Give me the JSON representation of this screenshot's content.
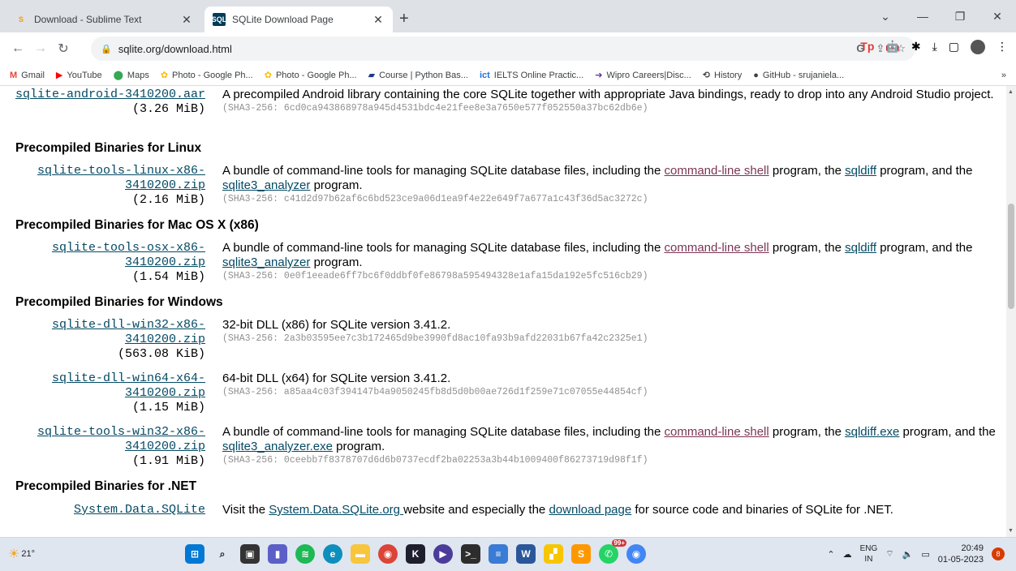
{
  "tabs": [
    {
      "title": "Download - Sublime Text",
      "icon": "sublime-icon",
      "active": false
    },
    {
      "title": "SQLite Download Page",
      "icon": "sqlite-icon",
      "active": true
    }
  ],
  "address_bar": {
    "url": "sqlite.org/download.html"
  },
  "bookmarks": [
    {
      "label": "Gmail",
      "icon": "gmail-icon",
      "color": "#ea4335"
    },
    {
      "label": "YouTube",
      "icon": "youtube-icon",
      "color": "#ff0000"
    },
    {
      "label": "Maps",
      "icon": "maps-icon",
      "color": "#34a853"
    },
    {
      "label": "Photo - Google Ph...",
      "icon": "photos-icon",
      "color": "#fbbc04"
    },
    {
      "label": "Photo - Google Ph...",
      "icon": "photos-icon",
      "color": "#fbbc04"
    },
    {
      "label": "Course | Python Bas...",
      "icon": "course-icon",
      "color": "#1f3c88"
    },
    {
      "label": "IELTS Online Practic...",
      "icon": "ielts-icon",
      "color": "#1a73e8"
    },
    {
      "label": "Wipro Careers|Disc...",
      "icon": "wipro-icon",
      "color": "#5b2d90"
    },
    {
      "label": "History",
      "icon": "history-icon",
      "color": "#3c4043"
    },
    {
      "label": "GitHub - srujaniela...",
      "icon": "github-icon",
      "color": "#000000"
    }
  ],
  "page": {
    "android": {
      "file": "sqlite-android-3410200.aar",
      "size": "(3.26 MiB)",
      "desc": "A precompiled Android library containing the core SQLite together with appropriate Java bindings, ready to drop into any Android Studio project.",
      "sha": "(SHA3-256: 6cd0ca943868978a945d4531bdc4e21fee8e3a7650e577f052550a37bc62db6e)"
    },
    "linux": {
      "heading": "Precompiled Binaries for Linux",
      "file1": "sqlite-tools-linux-x86-",
      "file2": "3410200.zip",
      "size": "(2.16 MiB)",
      "desc_a": "A bundle of command-line tools for managing SQLite database files, including the ",
      "link_shell": "command-line shell",
      "desc_b": " program, the ",
      "link_sqldiff": "sqldiff",
      "desc_c": " program, and the ",
      "link_analyzer": "sqlite3_analyzer",
      "desc_d": " program.",
      "sha": "(SHA3-256: c41d2d97b62af6c6bd523ce9a06d1ea9f4e22e649f7a677a1c43f36d5ac3272c)"
    },
    "mac": {
      "heading": "Precompiled Binaries for Mac OS X (x86)",
      "file1": "sqlite-tools-osx-x86-",
      "file2": "3410200.zip",
      "size": "(1.54 MiB)",
      "desc_a": "A bundle of command-line tools for managing SQLite database files, including the ",
      "link_shell": "command-line shell",
      "desc_b": " program, the ",
      "link_sqldiff": "sqldiff",
      "desc_c": " program, and the ",
      "link_analyzer": "sqlite3_analyzer",
      "desc_d": " program.",
      "sha": "(SHA3-256: 0e0f1eeade6ff7bc6f0ddbf0fe86798a595494328e1afa15da192e5fc516cb29)"
    },
    "windows": {
      "heading": "Precompiled Binaries for Windows",
      "dll32": {
        "file1": "sqlite-dll-win32-x86-",
        "file2": "3410200.zip",
        "size": "(563.08 KiB)",
        "desc": "32-bit DLL (x86) for SQLite version 3.41.2.",
        "sha": "(SHA3-256: 2a3b03595ee7c3b172465d9be3990fd8ac10fa93b9afd22031b67fa42c2325e1)"
      },
      "dll64": {
        "file1": "sqlite-dll-win64-x64-",
        "file2": "3410200.zip",
        "size": "(1.15 MiB)",
        "desc": "64-bit DLL (x64) for SQLite version 3.41.2.",
        "sha": "(SHA3-256: a85aa4c03f394147b4a9050245fb8d5d0b00ae726d1f259e71c07055e44854cf)"
      },
      "tools": {
        "file1": "sqlite-tools-win32-x86-",
        "file2": "3410200.zip",
        "size": "(1.91 MiB)",
        "desc_a": "A bundle of command-line tools for managing SQLite database files, including the ",
        "link_shell": "command-line shell",
        "desc_b": " program, the ",
        "link_sqldiff": "sqldiff.exe",
        "desc_c": " program, and the ",
        "link_analyzer": "sqlite3_analyzer.exe",
        "desc_d": " program.",
        "sha": "(SHA3-256: 0ceebb7f8378707d6d6b0737ecdf2ba02253a3b44b1009400f86273719d98f1f)"
      }
    },
    "dotnet": {
      "heading": "Precompiled Binaries for .NET",
      "file": "System.Data.SQLite",
      "desc_a": "Visit the ",
      "link_site": "System.Data.SQLite.org ",
      "desc_b": "website and especially the ",
      "link_download": "download page",
      "desc_c": " for source code and binaries of SQLite for .NET."
    }
  },
  "taskbar": {
    "weather": "21°",
    "lang_top": "ENG",
    "lang_bottom": "IN",
    "time": "20:49",
    "date": "01-05-2023",
    "notifications": "8",
    "whatsapp_badge": "99+"
  }
}
